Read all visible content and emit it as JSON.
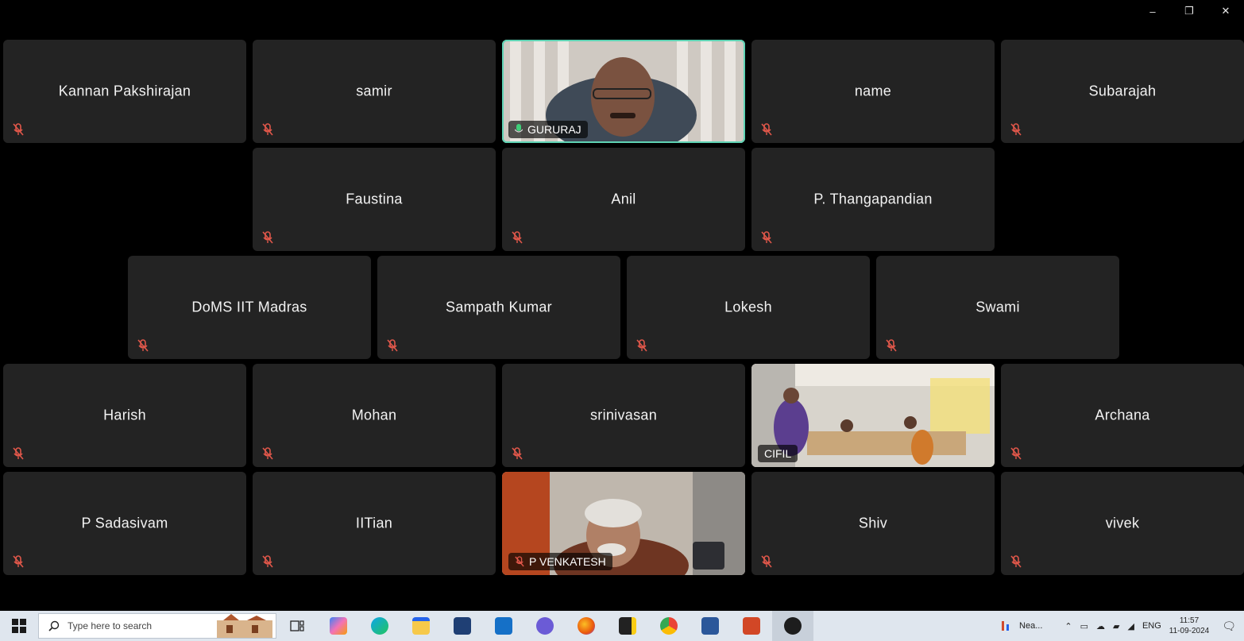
{
  "window_controls": [
    "–",
    "❐",
    "✕"
  ],
  "participants": [
    {
      "name": "Kannan Pakshirajan",
      "muted": true,
      "video": false
    },
    {
      "name": "samir",
      "muted": true,
      "video": false
    },
    {
      "name": "GURURAJ",
      "muted": false,
      "video": true,
      "active": true
    },
    {
      "name": "name",
      "muted": true,
      "video": false
    },
    {
      "name": "Subarajah",
      "muted": true,
      "video": false
    },
    {
      "name": "Faustina",
      "muted": true,
      "video": false
    },
    {
      "name": "Anil",
      "muted": true,
      "video": false
    },
    {
      "name": "P. Thangapandian",
      "muted": true,
      "video": false
    },
    {
      "name": "DoMS IIT Madras",
      "muted": true,
      "video": false
    },
    {
      "name": "Sampath Kumar",
      "muted": true,
      "video": false
    },
    {
      "name": "Lokesh",
      "muted": true,
      "video": false
    },
    {
      "name": "Swami",
      "muted": true,
      "video": false
    },
    {
      "name": "Harish",
      "muted": true,
      "video": false
    },
    {
      "name": "Mohan",
      "muted": true,
      "video": false
    },
    {
      "name": "srinivasan",
      "muted": true,
      "video": false
    },
    {
      "name": "CIFIL",
      "muted": false,
      "video": true
    },
    {
      "name": "Archana",
      "muted": true,
      "video": false
    },
    {
      "name": "P Sadasivam",
      "muted": true,
      "video": false
    },
    {
      "name": "IITian",
      "muted": true,
      "video": false
    },
    {
      "name": "P VENKATESH",
      "muted": true,
      "video": true
    },
    {
      "name": "Shiv",
      "muted": true,
      "video": false
    },
    {
      "name": "vivek",
      "muted": true,
      "video": false
    }
  ],
  "taskbar": {
    "search_placeholder": "Type here to search",
    "apps": [
      "task-view-icon",
      "copilot-icon",
      "edge-icon",
      "file-explorer-icon",
      "store-icon",
      "mail-icon",
      "teams-icon",
      "firefox-icon",
      "sticky-notes-icon",
      "chrome-icon",
      "word-icon",
      "powerpoint-icon",
      "zoom-icon"
    ],
    "weather": "Nea...",
    "language": "ENG",
    "time": "11:57",
    "date": "11-09-2024"
  },
  "colors": {
    "background": "#000000",
    "tile": "#232323",
    "active_border": "#5fd3b4",
    "muted_icon": "#e0574a"
  }
}
